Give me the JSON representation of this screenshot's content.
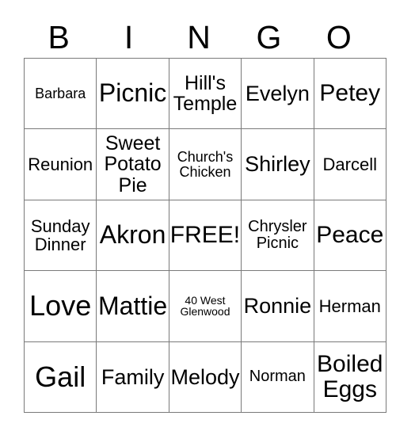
{
  "card": {
    "header": {
      "letters": [
        "B",
        "I",
        "N",
        "G",
        "O"
      ]
    },
    "free_space_label": "FREE!",
    "rows": [
      [
        {
          "text": "Barbara",
          "size": "fs-xxs"
        },
        {
          "text": "Picnic",
          "size": "fs-xl"
        },
        {
          "text": "Hill's Temple",
          "size": "fs-md"
        },
        {
          "text": "Evelyn",
          "size": "fs-ml"
        },
        {
          "text": "Petey",
          "size": "fs-lg"
        }
      ],
      [
        {
          "text": "Reunion",
          "size": "fs-sm"
        },
        {
          "text": "Sweet Potato Pie",
          "size": "fs-md"
        },
        {
          "text": "Church's Chicken",
          "size": "fs-xxs"
        },
        {
          "text": "Shirley",
          "size": "fs-ml"
        },
        {
          "text": "Darcell",
          "size": "fs-sm"
        }
      ],
      [
        {
          "text": "Sunday Dinner",
          "size": "fs-sm"
        },
        {
          "text": "Akron",
          "size": "fs-xl"
        },
        {
          "text": "FREE!",
          "size": "fs-lg"
        },
        {
          "text": "Chrysler Picnic",
          "size": "fs-xs"
        },
        {
          "text": "Peace",
          "size": "fs-lg"
        }
      ],
      [
        {
          "text": "Love",
          "size": "fs-xxl"
        },
        {
          "text": "Mattie",
          "size": "fs-xl"
        },
        {
          "text": "40 West Glenwood",
          "size": "fs-tiny"
        },
        {
          "text": "Ronnie",
          "size": "fs-ml"
        },
        {
          "text": "Herman",
          "size": "fs-sm"
        }
      ],
      [
        {
          "text": "Gail",
          "size": "fs-xxl"
        },
        {
          "text": "Family",
          "size": "fs-ml"
        },
        {
          "text": "Melody",
          "size": "fs-ml"
        },
        {
          "text": "Norman",
          "size": "fs-xs"
        },
        {
          "text": "Boiled Eggs",
          "size": "fs-lg"
        }
      ]
    ]
  },
  "colors": {
    "background": "#ffffff",
    "text": "#000000",
    "grid_line": "#7a7a7a"
  }
}
